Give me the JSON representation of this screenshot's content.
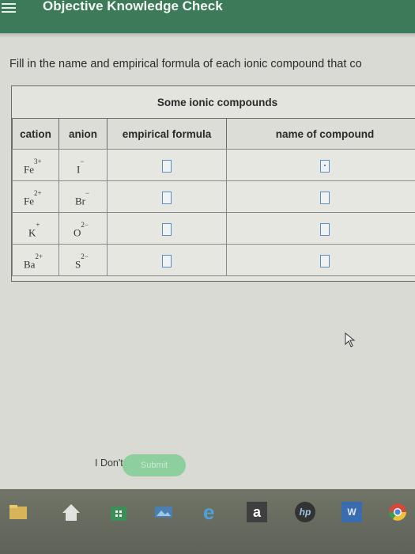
{
  "header": {
    "title": "Objective Knowledge Check"
  },
  "instruction": "Fill in the name and empirical formula of each ionic compound that co",
  "table": {
    "caption": "Some ionic compounds",
    "columns": [
      "cation",
      "anion",
      "empirical formula",
      "name of compound"
    ],
    "rows": [
      {
        "cation": "Fe",
        "cation_charge": "3+",
        "anion": "I",
        "anion_charge": "−"
      },
      {
        "cation": "Fe",
        "cation_charge": "2+",
        "anion": "Br",
        "anion_charge": "−"
      },
      {
        "cation": "K",
        "cation_charge": "+",
        "anion": "O",
        "anion_charge": "2−"
      },
      {
        "cation": "Ba",
        "cation_charge": "2+",
        "anion": "S",
        "anion_charge": "2−"
      }
    ]
  },
  "actions": {
    "dont_know": "I Don't Know",
    "submit": "Submit"
  },
  "taskbar": {
    "icons": [
      "file-explorer-icon",
      "home-icon",
      "store-icon",
      "photos-icon",
      "edge-icon",
      "amazon-icon",
      "hp-icon",
      "word-icon",
      "chrome-icon"
    ],
    "amazon_letter": "a",
    "hp_letters": "hp",
    "word_letter": "W"
  },
  "colors": {
    "header": "#3d7a5a",
    "accent_box": "#5a8ec0",
    "submit": "#8ecf9e"
  }
}
